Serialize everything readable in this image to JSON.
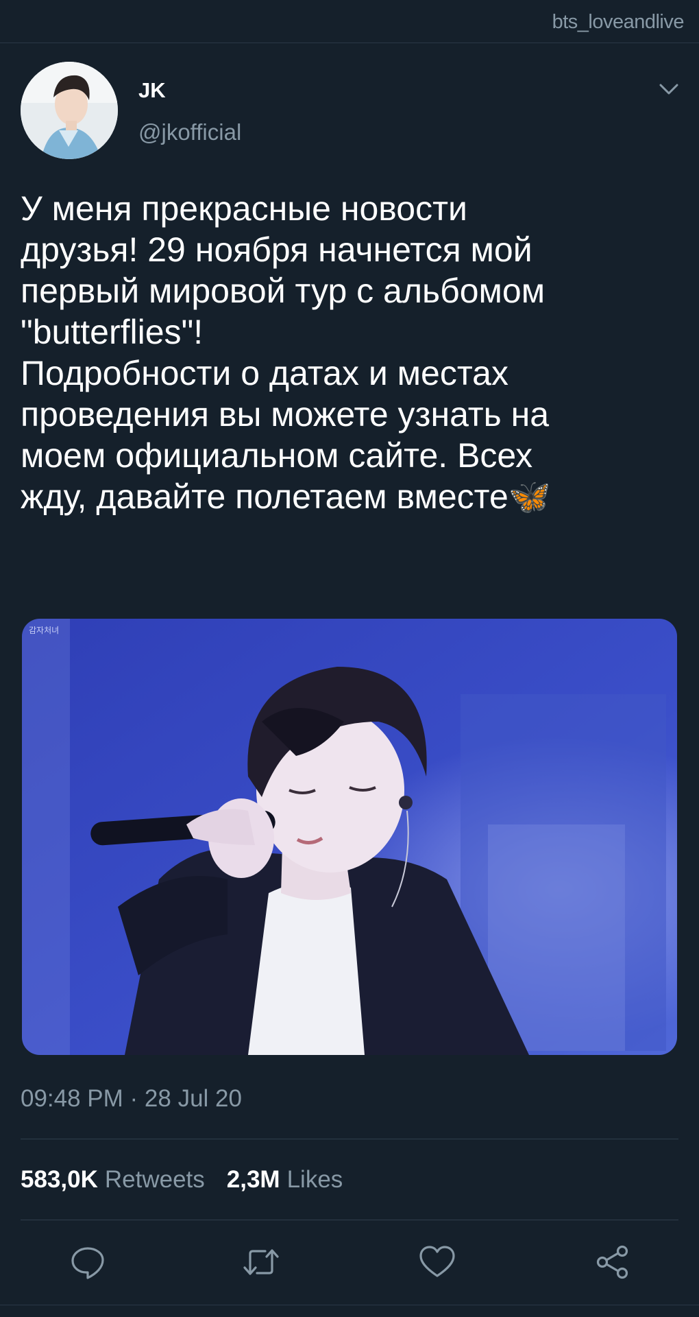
{
  "watermark": "bts_loveandlive",
  "author": {
    "name": "JK",
    "handle": "@jkofficial"
  },
  "tweet": {
    "text": "У меня прекрасные новости\nдрузья! 29 ноября начнется мой\nпервый мировой тур с альбомом\n\"butterflies\"!\nПодробности о датах и местах\nпроведения вы можете узнать на\nмоем официальном сайте. Всех\nжду, давайте полетаем вместе🦋",
    "media_badge": "감자처녀",
    "timestamp": "09:48 PM · 28 Jul 20"
  },
  "stats": {
    "retweets_count": "583,0K",
    "retweets_label": "Retweets",
    "likes_count": "2,3M",
    "likes_label": "Likes"
  },
  "actions": [
    "reply-icon",
    "retweet-icon",
    "like-icon",
    "share-icon"
  ],
  "colors": {
    "background": "#15202b",
    "secondary_text": "#8899a6",
    "divider": "#2f3e4d"
  }
}
